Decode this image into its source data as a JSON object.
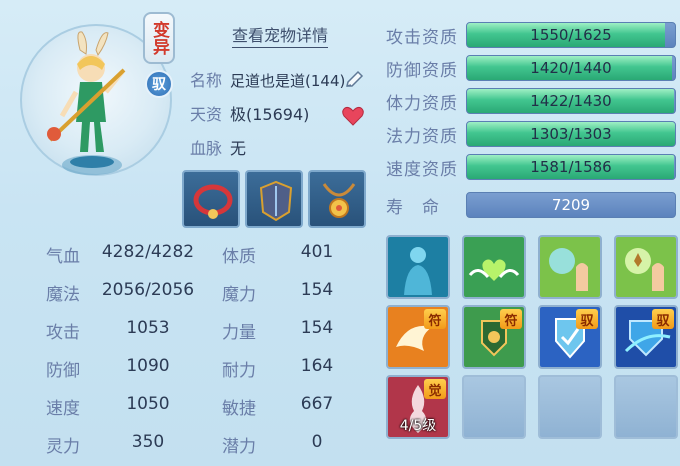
{
  "pet": {
    "badge_mutant": "变异",
    "badge_ride": "驭",
    "detail_link": "查看宠物详情",
    "info": [
      {
        "label": "名称",
        "value": "足道也是道(144)"
      },
      {
        "label": "天资",
        "value": "极(15694)"
      },
      {
        "label": "血脉",
        "value": "无"
      }
    ],
    "equipment": [
      {
        "icon": "red-collar-icon"
      },
      {
        "icon": "armor-icon"
      },
      {
        "icon": "amulet-icon"
      }
    ]
  },
  "stats": {
    "left": [
      {
        "label": "气血",
        "value": "4282/4282"
      },
      {
        "label": "魔法",
        "value": "2056/2056"
      },
      {
        "label": "攻击",
        "value": "1053"
      },
      {
        "label": "防御",
        "value": "1090"
      },
      {
        "label": "速度",
        "value": "1050"
      },
      {
        "label": "灵力",
        "value": "350"
      }
    ],
    "right": [
      {
        "label": "体质",
        "value": "401"
      },
      {
        "label": "魔力",
        "value": "154"
      },
      {
        "label": "力量",
        "value": "154"
      },
      {
        "label": "耐力",
        "value": "164"
      },
      {
        "label": "敏捷",
        "value": "667"
      },
      {
        "label": "潜力",
        "value": "0"
      }
    ]
  },
  "aptitudes": [
    {
      "label": "攻击资质",
      "text": "1550/1625",
      "fraction": 0.954
    },
    {
      "label": "防御资质",
      "text": "1420/1440",
      "fraction": 0.986
    },
    {
      "label": "体力资质",
      "text": "1422/1430",
      "fraction": 0.994
    },
    {
      "label": "法力资质",
      "text": "1303/1303",
      "fraction": 1.0
    },
    {
      "label": "速度资质",
      "text": "1581/1586",
      "fraction": 0.997
    },
    {
      "label": "寿　命",
      "text": "7209",
      "fraction": 0.0
    }
  ],
  "skills": [
    {
      "icon": "spirit-body-icon",
      "tag": "",
      "level": ""
    },
    {
      "icon": "heart-wings-icon",
      "tag": "",
      "level": ""
    },
    {
      "icon": "water-hand-icon",
      "tag": "",
      "level": ""
    },
    {
      "icon": "earth-hand-icon",
      "tag": "",
      "level": ""
    },
    {
      "icon": "wings-talisman-icon",
      "tag": "符",
      "level": ""
    },
    {
      "icon": "shield-talisman-icon",
      "tag": "符",
      "level": ""
    },
    {
      "icon": "ride-shield-icon",
      "tag": "驭",
      "level": ""
    },
    {
      "icon": "ride-guard-icon",
      "tag": "驭",
      "level": ""
    },
    {
      "icon": "awakening-icon",
      "tag": "觉",
      "level": "4/5级"
    },
    {
      "icon": "",
      "tag": "",
      "level": ""
    },
    {
      "icon": "",
      "tag": "",
      "level": ""
    },
    {
      "icon": "",
      "tag": "",
      "level": ""
    }
  ]
}
